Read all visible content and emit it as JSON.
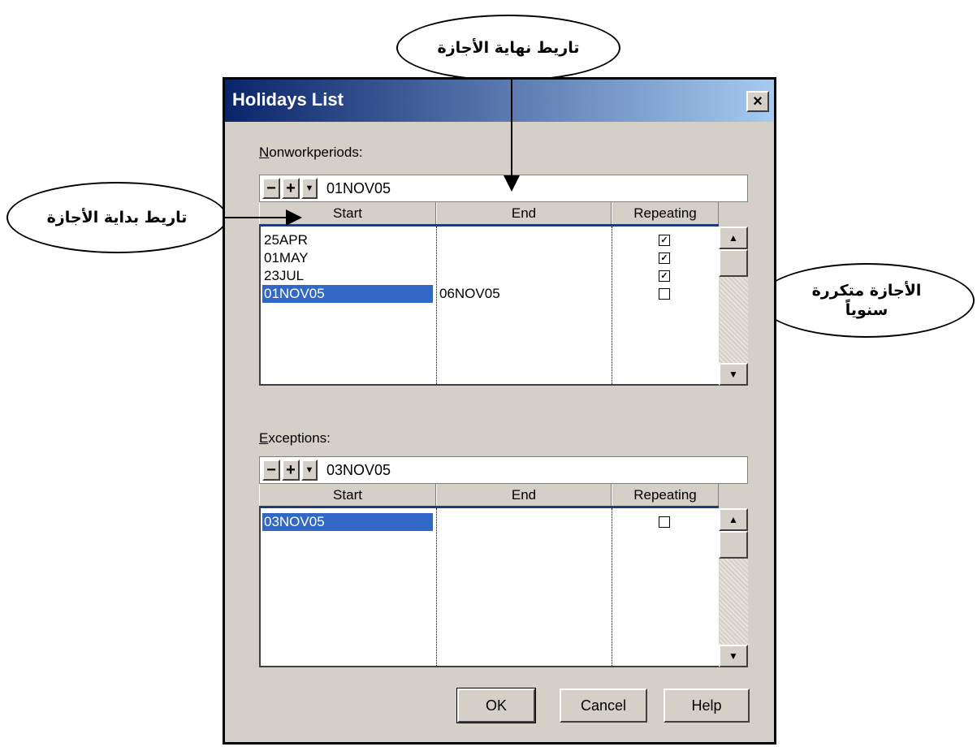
{
  "annotations": {
    "end_date": "تاريط نهاية الأجازة",
    "start_date": "تاريط بداية الأجازة",
    "repeating_line1": "الأجازة متكررة",
    "repeating_line2": "سنوياً"
  },
  "dialog": {
    "title": "Holidays List",
    "close_symbol": "×"
  },
  "nonwork": {
    "label_first": "N",
    "label_rest": "onworkperiods:",
    "toolbar": {
      "minus": "−",
      "plus": "+",
      "dropdown": "▼",
      "value": "01NOV05"
    },
    "columns": {
      "start": "Start",
      "end": "End",
      "repeating": "Repeating"
    },
    "rows": [
      {
        "start": "25APR",
        "end": "",
        "repeating": true,
        "selected": false
      },
      {
        "start": "01MAY",
        "end": "",
        "repeating": true,
        "selected": false
      },
      {
        "start": "23JUL",
        "end": "",
        "repeating": true,
        "selected": false
      },
      {
        "start": "01NOV05",
        "end": "06NOV05",
        "repeating": false,
        "selected": true
      }
    ]
  },
  "exceptions": {
    "label_first": "E",
    "label_rest": "xceptions:",
    "toolbar": {
      "minus": "−",
      "plus": "+",
      "dropdown": "▼",
      "value": "03NOV05"
    },
    "columns": {
      "start": "Start",
      "end": "End",
      "repeating": "Repeating"
    },
    "rows": [
      {
        "start": "03NOV05",
        "end": "",
        "repeating": false,
        "selected": true
      }
    ]
  },
  "scroll": {
    "up": "▲",
    "down": "▼"
  },
  "buttons": {
    "ok": "OK",
    "cancel": "Cancel",
    "help": "Help"
  },
  "colors": {
    "title_start": "#0a246a",
    "title_end": "#a6caf0",
    "selection": "#3168c6",
    "dialog_bg": "#d4d0c8"
  }
}
